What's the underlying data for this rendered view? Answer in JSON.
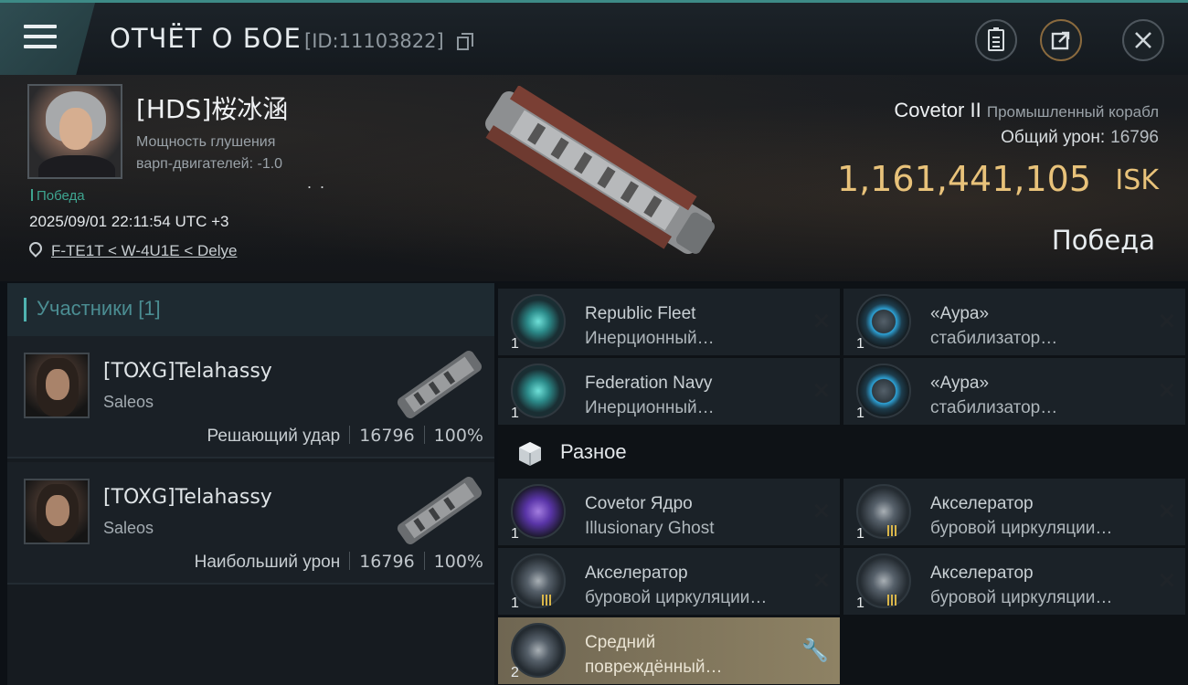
{
  "header": {
    "title": "ОТЧЁТ О БОЕ",
    "report_id": "[ID:11103822]"
  },
  "victim": {
    "name": "[HDS]桜冰涵",
    "desc_line1": "Мощность глушения",
    "desc_line2": "варп-двигателей: -1.0",
    "status_small": "Победа",
    "datetime": "2025/09/01 22:11:54 UTC +3",
    "location": "F-TE1T < W-4U1E < Delye",
    "ship_name": "Covetor II",
    "ship_class": "Промышленный корабл",
    "damage_label": "Общий урон:",
    "damage_value": "16796",
    "isk_value": "1,161,441,105",
    "isk_unit": "ISK",
    "result": "Победа"
  },
  "participants": {
    "header": "Участники [1]",
    "list": [
      {
        "name": "[TOXG]Telahassy",
        "ship": "Saleos",
        "role": "Решающий удар",
        "damage": "16796",
        "percent": "100%"
      },
      {
        "name": "[TOXG]Telahassy",
        "ship": "Saleos",
        "role": "Наибольший урон",
        "damage": "16796",
        "percent": "100%"
      }
    ]
  },
  "items": [
    {
      "qty": "1",
      "line1": "Republic Fleet",
      "line2": "Инерционный…",
      "icon": "inertial-stabilizer-icon"
    },
    {
      "qty": "1",
      "line1": "«Аура»",
      "line2": "стабилизатор…",
      "icon": "aura-stabilizer-icon"
    },
    {
      "qty": "1",
      "line1": "Federation Navy",
      "line2": "Инерционный…",
      "icon": "inertial-stabilizer-icon"
    },
    {
      "qty": "1",
      "line1": "«Аура»",
      "line2": "стабилизатор…",
      "icon": "aura-stabilizer-icon"
    }
  ],
  "misc_section": {
    "label": "Разное"
  },
  "misc_items": [
    {
      "qty": "1",
      "line1": "Covetor Ядро",
      "line2": "Illusionary Ghost",
      "icon": "core-icon"
    },
    {
      "qty": "1",
      "line1": "Акселератор",
      "line2": "буровой циркуляции…",
      "icon": "accelerator-icon"
    },
    {
      "qty": "1",
      "line1": "Акселератор",
      "line2": "буровой циркуляции…",
      "icon": "accelerator-icon"
    },
    {
      "qty": "1",
      "line1": "Акселератор",
      "line2": "буровой циркуляции…",
      "icon": "accelerator-icon"
    },
    {
      "qty": "2",
      "line1": "Средний",
      "line2": "повреждённый…",
      "icon": "damaged-module-icon"
    }
  ],
  "colors": {
    "accent_teal": "#4fb3b0",
    "isk_gold": "#e8c27a",
    "victory_green": "#3ea590"
  }
}
